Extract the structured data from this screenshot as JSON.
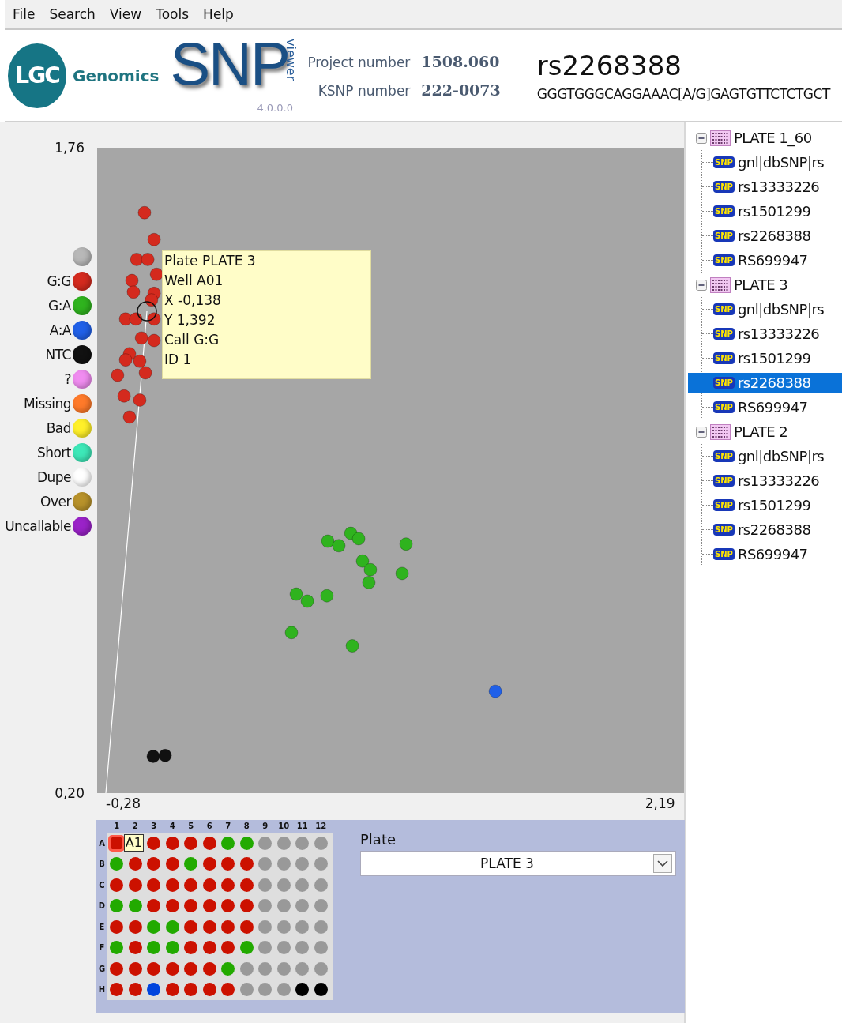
{
  "menu": [
    "File",
    "Search",
    "View",
    "Tools",
    "Help"
  ],
  "header": {
    "logo_text": "LGC",
    "company": "Genomics",
    "product": "SNP",
    "product_suffix": "viewer",
    "version": "4.0.0.0",
    "fields": [
      {
        "label": "Project number",
        "value": "1508.060"
      },
      {
        "label": "KSNP number",
        "value": "222-0073"
      }
    ],
    "snp_id": "rs2268388",
    "sequence": "GGGTGGGCAGGAAAC[A/G]GAGTGTTCTCTGCT"
  },
  "legend": [
    {
      "color": "#b8b8b8"
    },
    {
      "label": "?",
      "color": "#f08cf0"
    },
    {
      "label": "Missing",
      "color": "#ff7a2a"
    },
    {
      "label": "Bad",
      "color": "#fff02a"
    },
    {
      "label": "Short",
      "color": "#3de8b8"
    },
    {
      "label": "Dupe",
      "color": "#ffffff"
    },
    {
      "label": "Over",
      "color": "#b8922a"
    },
    {
      "label": "Uncallable",
      "color": "#9a22c8"
    }
  ],
  "chart_data": {
    "type": "scatter",
    "xlim": [
      -0.4,
      2.3
    ],
    "ylim": [
      0.2,
      1.76
    ],
    "legend": true,
    "xticks": [
      {
        "value": -0.28,
        "label": "-0,28"
      },
      {
        "value": 2.19,
        "label": "2,19"
      }
    ],
    "yticks": [
      {
        "value": 0.2,
        "label": "0,20"
      },
      {
        "value": 1.76,
        "label": "1,76"
      }
    ],
    "series": [
      {
        "name": "G:G",
        "color": "#d42a1e",
        "x": [
          -0.182,
          -0.138,
          -0.218,
          -0.167,
          -0.127,
          -0.24,
          -0.233,
          -0.138,
          -0.15,
          -0.269,
          -0.222,
          -0.138,
          -0.196,
          -0.138,
          -0.251,
          -0.269,
          -0.204,
          -0.306,
          -0.178,
          -0.276,
          -0.204,
          -0.251
        ],
        "values": [
          1.603,
          1.538,
          1.49,
          1.49,
          1.454,
          1.439,
          1.411,
          1.408,
          1.392,
          1.346,
          1.346,
          1.346,
          1.3,
          1.294,
          1.262,
          1.247,
          1.244,
          1.21,
          1.216,
          1.16,
          1.15,
          1.109
        ]
      },
      {
        "name": "G:A",
        "color": "#2fb31e",
        "x": [
          0.661,
          0.712,
          0.767,
          0.803,
          1.021,
          0.821,
          0.857,
          0.85,
          1.003,
          0.516,
          0.567,
          0.657,
          0.494,
          0.774
        ],
        "values": [
          0.809,
          0.798,
          0.828,
          0.815,
          0.802,
          0.761,
          0.74,
          0.709,
          0.731,
          0.681,
          0.664,
          0.677,
          0.588,
          0.556
        ]
      },
      {
        "name": "A:A",
        "color": "#2060e8",
        "x": [
          1.432
        ],
        "values": [
          0.446
        ]
      },
      {
        "name": "NTC",
        "color": "#111111",
        "x": [
          -0.142,
          -0.087
        ],
        "values": [
          0.289,
          0.291
        ]
      }
    ]
  },
  "tooltip": {
    "lines": [
      "Plate PLATE 3",
      "Well A01",
      "X -0,138",
      "Y 1,392",
      "Call G:G",
      "ID 1"
    ]
  },
  "plate": {
    "columns": [
      "1",
      "2",
      "3",
      "4",
      "5",
      "6",
      "7",
      "8",
      "9",
      "10",
      "11",
      "12"
    ],
    "well_tooltip": "A1",
    "rows": [
      {
        "label": "A",
        "wells": [
          {
            "color": "#cc1100",
            "selected": true
          },
          {
            "kind": "covered"
          },
          {
            "color": "#cc1100",
            "selected": false
          },
          {
            "color": "#cc1100",
            "selected": false
          },
          {
            "color": "#cc1100",
            "selected": false
          },
          {
            "color": "#cc1100",
            "selected": false
          },
          {
            "color": "#22aa00",
            "selected": false
          },
          {
            "color": "#22aa00",
            "selected": false
          },
          {
            "color": "#999999",
            "selected": false
          },
          {
            "color": "#999999",
            "selected": false
          },
          {
            "color": "#999999",
            "selected": false
          },
          {
            "color": "#999999",
            "selected": false
          }
        ]
      },
      {
        "label": "B",
        "wells": [
          {
            "color": "#22aa00",
            "selected": false
          },
          {
            "color": "#cc1100",
            "selected": false
          },
          {
            "color": "#cc1100",
            "selected": false
          },
          {
            "color": "#cc1100",
            "selected": false
          },
          {
            "color": "#22aa00",
            "selected": false
          },
          {
            "color": "#cc1100",
            "selected": false
          },
          {
            "color": "#cc1100",
            "selected": false
          },
          {
            "color": "#cc1100",
            "selected": false
          },
          {
            "color": "#999999",
            "selected": false
          },
          {
            "color": "#999999",
            "selected": false
          },
          {
            "color": "#999999",
            "selected": false
          },
          {
            "color": "#999999",
            "selected": false
          }
        ]
      },
      {
        "label": "C",
        "wells": [
          {
            "color": "#cc1100",
            "selected": false
          },
          {
            "color": "#cc1100",
            "selected": false
          },
          {
            "color": "#cc1100",
            "selected": false
          },
          {
            "color": "#cc1100",
            "selected": false
          },
          {
            "color": "#cc1100",
            "selected": false
          },
          {
            "color": "#cc1100",
            "selected": false
          },
          {
            "color": "#cc1100",
            "selected": false
          },
          {
            "color": "#cc1100",
            "selected": false
          },
          {
            "color": "#999999",
            "selected": false
          },
          {
            "color": "#999999",
            "selected": false
          },
          {
            "color": "#999999",
            "selected": false
          },
          {
            "color": "#999999",
            "selected": false
          }
        ]
      },
      {
        "label": "D",
        "wells": [
          {
            "color": "#22aa00",
            "selected": false
          },
          {
            "color": "#22aa00",
            "selected": false
          },
          {
            "color": "#cc1100",
            "selected": false
          },
          {
            "color": "#cc1100",
            "selected": false
          },
          {
            "color": "#cc1100",
            "selected": false
          },
          {
            "color": "#cc1100",
            "selected": false
          },
          {
            "color": "#cc1100",
            "selected": false
          },
          {
            "color": "#cc1100",
            "selected": false
          },
          {
            "color": "#999999",
            "selected": false
          },
          {
            "color": "#999999",
            "selected": false
          },
          {
            "color": "#999999",
            "selected": false
          },
          {
            "color": "#999999",
            "selected": false
          }
        ]
      },
      {
        "label": "E",
        "wells": [
          {
            "color": "#cc1100",
            "selected": false
          },
          {
            "color": "#cc1100",
            "selected": false
          },
          {
            "color": "#22aa00",
            "selected": false
          },
          {
            "color": "#22aa00",
            "selected": false
          },
          {
            "color": "#cc1100",
            "selected": false
          },
          {
            "color": "#cc1100",
            "selected": false
          },
          {
            "color": "#cc1100",
            "selected": false
          },
          {
            "color": "#cc1100",
            "selected": false
          },
          {
            "color": "#999999",
            "selected": false
          },
          {
            "color": "#999999",
            "selected": false
          },
          {
            "color": "#999999",
            "selected": false
          },
          {
            "color": "#999999",
            "selected": false
          }
        ]
      },
      {
        "label": "F",
        "wells": [
          {
            "color": "#22aa00",
            "selected": false
          },
          {
            "color": "#cc1100",
            "selected": false
          },
          {
            "color": "#22aa00",
            "selected": false
          },
          {
            "color": "#22aa00",
            "selected": false
          },
          {
            "color": "#cc1100",
            "selected": false
          },
          {
            "color": "#cc1100",
            "selected": false
          },
          {
            "color": "#cc1100",
            "selected": false
          },
          {
            "color": "#22aa00",
            "selected": false
          },
          {
            "color": "#999999",
            "selected": false
          },
          {
            "color": "#999999",
            "selected": false
          },
          {
            "color": "#999999",
            "selected": false
          },
          {
            "color": "#999999",
            "selected": false
          }
        ]
      },
      {
        "label": "G",
        "wells": [
          {
            "color": "#cc1100",
            "selected": false
          },
          {
            "color": "#cc1100",
            "selected": false
          },
          {
            "color": "#cc1100",
            "selected": false
          },
          {
            "color": "#cc1100",
            "selected": false
          },
          {
            "color": "#cc1100",
            "selected": false
          },
          {
            "color": "#cc1100",
            "selected": false
          },
          {
            "color": "#22aa00",
            "selected": false
          },
          {
            "color": "#999999",
            "selected": false
          },
          {
            "color": "#999999",
            "selected": false
          },
          {
            "color": "#999999",
            "selected": false
          },
          {
            "color": "#999999",
            "selected": false
          },
          {
            "color": "#999999",
            "selected": false
          }
        ]
      },
      {
        "label": "H",
        "wells": [
          {
            "color": "#cc1100",
            "selected": false
          },
          {
            "color": "#cc1100",
            "selected": false
          },
          {
            "color": "#0044dd",
            "selected": false
          },
          {
            "color": "#cc1100",
            "selected": false
          },
          {
            "color": "#cc1100",
            "selected": false
          },
          {
            "color": "#cc1100",
            "selected": false
          },
          {
            "color": "#cc1100",
            "selected": false
          },
          {
            "color": "#999999",
            "selected": false
          },
          {
            "color": "#999999",
            "selected": false
          },
          {
            "color": "#999999",
            "selected": false
          },
          {
            "color": "#000000",
            "selected": false
          },
          {
            "color": "#000000",
            "selected": false
          }
        ]
      }
    ]
  },
  "plate_select": {
    "label": "Plate",
    "value": "PLATE 3"
  },
  "tree": [
    {
      "label": "PLATE 1_60",
      "expanded": true,
      "children": [
        {
          "label": "gnl|dbSNP|rs",
          "badge": "SNP",
          "selected": false
        },
        {
          "label": "rs13333226",
          "badge": "SNP",
          "selected": false
        },
        {
          "label": "rs1501299",
          "badge": "SNP",
          "selected": false
        },
        {
          "label": "rs2268388",
          "badge": "SNP",
          "selected": false
        },
        {
          "label": "RS699947",
          "badge": "SNP",
          "selected": false
        }
      ]
    },
    {
      "label": "PLATE 3",
      "expanded": true,
      "children": [
        {
          "label": "gnl|dbSNP|rs",
          "badge": "SNP",
          "selected": false
        },
        {
          "label": "rs13333226",
          "badge": "SNP",
          "selected": false
        },
        {
          "label": "rs1501299",
          "badge": "SNP",
          "selected": false
        },
        {
          "label": "rs2268388",
          "badge": "SNP",
          "selected": true
        },
        {
          "label": "RS699947",
          "badge": "SNP",
          "selected": false
        }
      ]
    },
    {
      "label": "PLATE 2",
      "expanded": true,
      "children": [
        {
          "label": "gnl|dbSNP|rs",
          "badge": "SNP",
          "selected": false
        },
        {
          "label": "rs13333226",
          "badge": "SNP",
          "selected": false
        },
        {
          "label": "rs1501299",
          "badge": "SNP",
          "selected": false
        },
        {
          "label": "rs2268388",
          "badge": "SNP",
          "selected": false
        },
        {
          "label": "RS699947",
          "badge": "SNP",
          "selected": false
        }
      ]
    }
  ]
}
